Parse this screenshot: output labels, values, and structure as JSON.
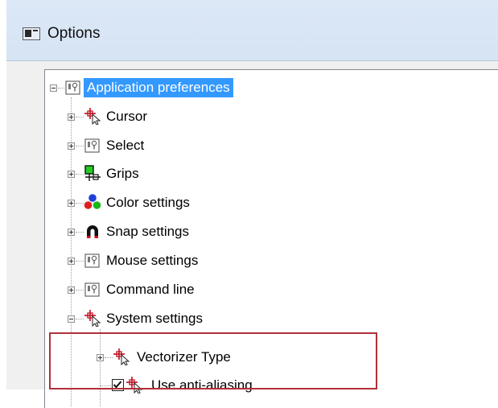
{
  "window": {
    "title": "Options"
  },
  "tree": {
    "root": {
      "label": "Application preferences",
      "icon": "settings-icon"
    },
    "items": [
      {
        "label": "Cursor",
        "icon": "crosshair-cursor-icon"
      },
      {
        "label": "Select",
        "icon": "settings-icon"
      },
      {
        "label": "Grips",
        "icon": "grips-icon"
      },
      {
        "label": "Color settings",
        "icon": "color-circles-icon"
      },
      {
        "label": "Snap settings",
        "icon": "magnet-icon"
      },
      {
        "label": "Mouse settings",
        "icon": "settings-icon"
      },
      {
        "label": "Command line",
        "icon": "settings-icon"
      },
      {
        "label": "System settings",
        "icon": "crosshair-cursor-icon"
      }
    ],
    "children": [
      {
        "label": "Vectorizer Type",
        "icon": "crosshair-cursor-icon"
      },
      {
        "label": "Use anti-aliasing",
        "icon": "crosshair-cursor-icon",
        "checked": true
      }
    ]
  },
  "colors": {
    "selection": "#3399ff",
    "highlight_border": "#b0303a"
  }
}
